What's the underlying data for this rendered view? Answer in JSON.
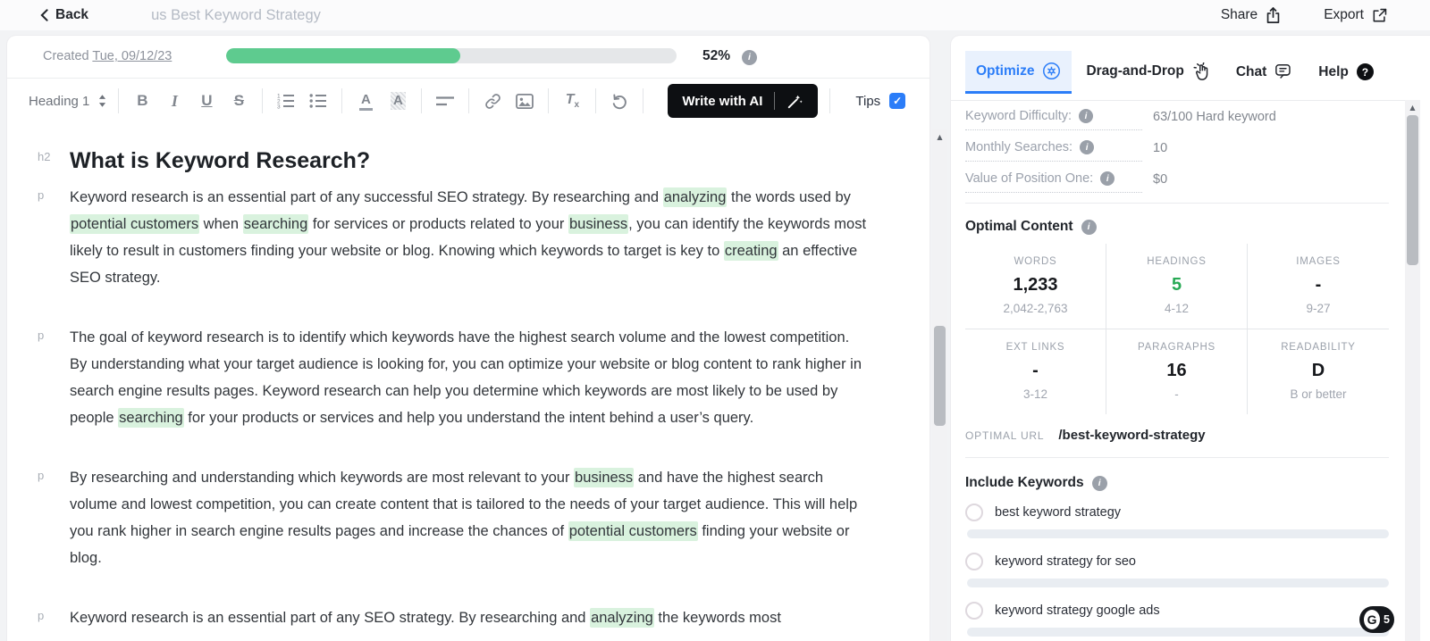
{
  "topbar": {
    "back": "Back",
    "title": "us Best Keyword Strategy",
    "share": "Share",
    "export": "Export"
  },
  "editor": {
    "created_label": "Created",
    "created_date": "Tue, 09/12/23",
    "progress_percent_label": "52%",
    "progress_value": 52,
    "toolbar": {
      "heading_select": "Heading 1",
      "write_with_ai": "Write with AI",
      "tips_label": "Tips",
      "tips_checked": true,
      "glyphs": {
        "bold": "B",
        "italic": "I",
        "underline": "U",
        "strikethrough": "S",
        "text-color": "A",
        "highlight-color": "A",
        "clear-formatting": "T",
        "clear-formatting-sub": "x"
      },
      "groups": [
        [
          "bold",
          "italic",
          "underline",
          "strikethrough"
        ],
        [
          "ordered-list",
          "bullet-list"
        ],
        [
          "text-color",
          "highlight-color"
        ],
        [
          "align"
        ],
        [
          "link",
          "image"
        ],
        [
          "clear-formatting"
        ],
        [
          "undo"
        ]
      ]
    },
    "content_blocks": [
      {
        "type": "h2",
        "gutter": "h2",
        "runs": [
          {
            "t": "What is Keyword Research?"
          }
        ]
      },
      {
        "type": "p",
        "gutter": "p",
        "runs": [
          {
            "t": "Keyword research is an essential part of any successful SEO strategy. By researching and "
          },
          {
            "t": "analyzing",
            "hl": true
          },
          {
            "t": " the words used by "
          },
          {
            "t": "potential customers",
            "hl": true
          },
          {
            "t": " when "
          },
          {
            "t": "searching",
            "hl": true
          },
          {
            "t": " for services or products related to your "
          },
          {
            "t": "business",
            "hl": true
          },
          {
            "t": ", you can identify the keywords most likely to result in customers finding your website or blog. Knowing which keywords to target is key to "
          },
          {
            "t": "creating",
            "hl": true
          },
          {
            "t": " an effective SEO strategy."
          }
        ]
      },
      {
        "type": "p",
        "gutter": "p",
        "runs": [
          {
            "t": "The goal of keyword research is to identify which keywords have the highest search volume and the lowest competition. By understanding what your target audience is looking for, you can optimize your website or blog content to rank higher in search engine results pages. Keyword research can help you determine which keywords are most likely to be used by people "
          },
          {
            "t": "searching",
            "hl": true
          },
          {
            "t": " for your products or services and help you understand the intent behind a user’s query."
          }
        ]
      },
      {
        "type": "p",
        "gutter": "p",
        "runs": [
          {
            "t": "By researching and understanding which keywords are most relevant to your "
          },
          {
            "t": "business",
            "hl": true
          },
          {
            "t": " and have the highest search volume and lowest competition, you can create content that is tailored to the needs of your target audience. This will help you rank higher in search engine results pages and increase the chances of "
          },
          {
            "t": "potential customers",
            "hl": true
          },
          {
            "t": " finding your website or blog."
          }
        ]
      },
      {
        "type": "p",
        "gutter": "p",
        "runs": [
          {
            "t": "Keyword research is an essential part of any SEO strategy. By researching and "
          },
          {
            "t": "analyzing",
            "hl": true
          },
          {
            "t": " the keywords most"
          }
        ]
      }
    ]
  },
  "sidebar": {
    "tabs": [
      {
        "label": "Optimize",
        "icon": "optimize-icon",
        "active": true
      },
      {
        "label": "Drag-and-Drop",
        "icon": "drag-icon",
        "active": false
      },
      {
        "label": "Chat",
        "icon": "chat-icon",
        "active": false
      },
      {
        "label": "Help",
        "icon": "help-icon",
        "active": false
      }
    ],
    "stats": [
      {
        "label": "Keyword Difficulty:",
        "value": "63/100 Hard keyword"
      },
      {
        "label": "Monthly Searches:",
        "value": "10"
      },
      {
        "label": "Value of Position One:",
        "value": "$0"
      }
    ],
    "optimal_content": {
      "title": "Optimal Content",
      "cells": [
        {
          "label": "WORDS",
          "value": "1,233",
          "range": "2,042-2,763",
          "green": false
        },
        {
          "label": "HEADINGS",
          "value": "5",
          "range": "4-12",
          "green": true
        },
        {
          "label": "IMAGES",
          "value": "-",
          "range": "9-27",
          "green": false
        },
        {
          "label": "EXT LINKS",
          "value": "-",
          "range": "3-12",
          "green": false
        },
        {
          "label": "PARAGRAPHS",
          "value": "16",
          "range": "-",
          "green": false
        },
        {
          "label": "READABILITY",
          "value": "D",
          "range": "B or better",
          "green": false
        }
      ]
    },
    "optimal_url": {
      "label": "OPTIMAL URL",
      "value": "/best-keyword-strategy"
    },
    "include_keywords": {
      "title": "Include Keywords",
      "items": [
        "best keyword strategy",
        "keyword strategy for seo",
        "keyword strategy google ads"
      ]
    }
  },
  "overlay": {
    "grammarly_count": "5"
  },
  "colors": {
    "progress_green": "#5ecb8f",
    "highlight_green": "#d9f2de",
    "accent_blue": "#2b7df8",
    "stat_green": "#27a954"
  }
}
